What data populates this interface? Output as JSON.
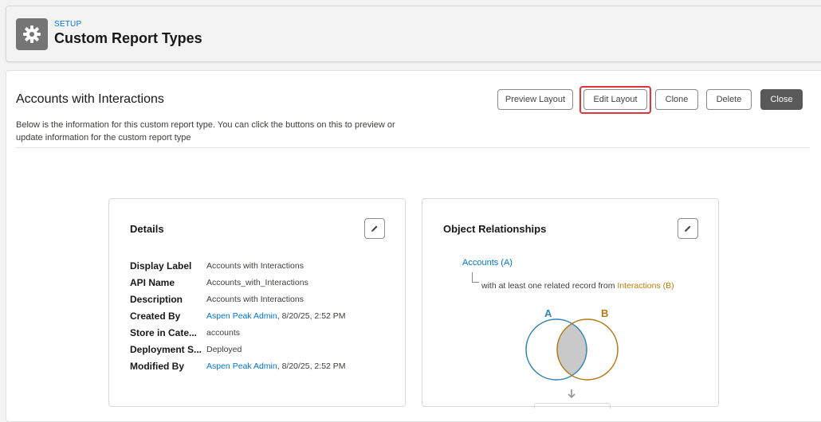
{
  "header": {
    "setup_label": "SETUP",
    "title": "Custom Report Types",
    "icon": "gear-icon"
  },
  "report": {
    "title": "Accounts with Interactions",
    "description": "Below is the information for this custom report type. You can click the buttons on this to preview or update information for the custom report type"
  },
  "buttons": {
    "preview": "Preview Layout",
    "edit_layout": "Edit Layout",
    "clone": "Clone",
    "delete": "Delete",
    "close": "Close"
  },
  "details": {
    "title": "Details",
    "rows": [
      {
        "label": "Display Label",
        "value": "Accounts with Interactions"
      },
      {
        "label": "API Name",
        "value": "Accounts_with_Interactions"
      },
      {
        "label": "Description",
        "value": "Accounts with Interactions"
      },
      {
        "label": "Created By",
        "link": "Aspen Peak Admin",
        "value": ", 8/20/25, 2:52 PM"
      },
      {
        "label": "Store in Cate...",
        "value": "accounts"
      },
      {
        "label": "Deployment S...",
        "value": "Deployed"
      },
      {
        "label": "Modified By",
        "link": "Aspen Peak Admin",
        "value": ", 8/20/25, 2:52 PM"
      }
    ]
  },
  "relationships": {
    "title": "Object Relationships",
    "primary": "Accounts (A)",
    "relation_text": "with at least one related record from ",
    "secondary": "Interactions (B)",
    "venn_a": "A",
    "venn_b": "B"
  },
  "colors": {
    "accent": "#0176d3",
    "highlight": "#e4343b",
    "orange": "#c27d0e",
    "close_bg": "#595959"
  }
}
